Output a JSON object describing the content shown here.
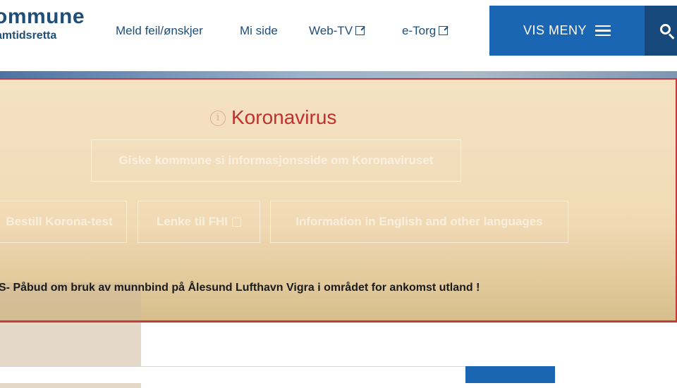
{
  "header": {
    "logo_name": "ommune",
    "logo_tag": "amtidsretta",
    "nav": [
      {
        "label": "Meld feil/ønskjer"
      },
      {
        "label": "Mi side"
      },
      {
        "label": "Web-TV"
      },
      {
        "label": "e-Torg"
      }
    ],
    "menu_label": "VIS MENY"
  },
  "banner": {
    "title": "Koronavirus",
    "info_link": "Giske kommune si informasjonsside om Koronaviruset",
    "links": [
      {
        "label": "Bestill Korona-test"
      },
      {
        "label": "Lenke til FHI"
      },
      {
        "label": "Information in English and other languages"
      }
    ],
    "notice": "S- Påbud om bruk av munnbind på Ålesund Lufthavn Vigra i området for ankomst utland !"
  },
  "colors": {
    "brand_blue": "#1b66b3",
    "dark_blue": "#16487c",
    "alert_red": "#c0302d"
  }
}
